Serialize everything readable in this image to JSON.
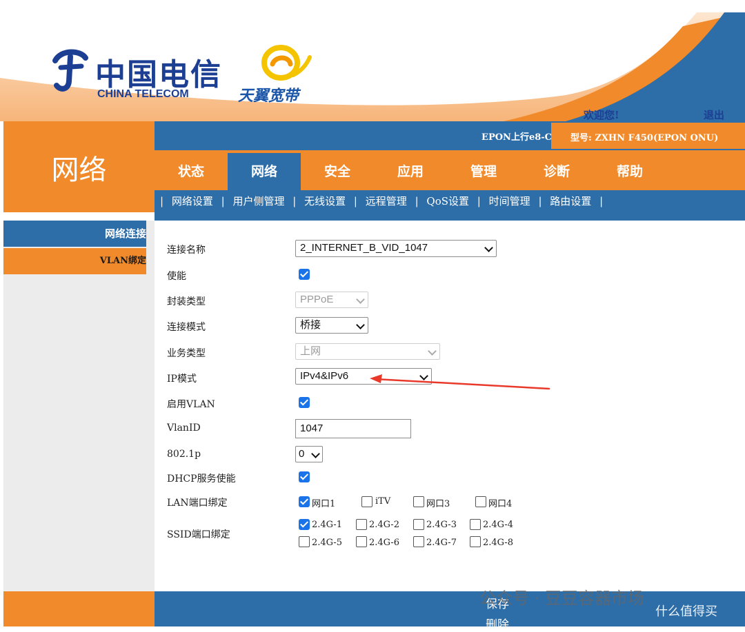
{
  "header": {
    "brand_cn": "中国电信",
    "brand_en": "CHINA TELECOM",
    "sub_brand": "天翼宽带",
    "welcome": "欢迎您!",
    "logout": "退出"
  },
  "top_bar": {
    "epon": "EPON上行e8-C",
    "model": "型号: ZXHN F450(EPON ONU)"
  },
  "section_title": "网络",
  "tabs": [
    {
      "label": "状态",
      "active": false
    },
    {
      "label": "网络",
      "active": true
    },
    {
      "label": "安全",
      "active": false
    },
    {
      "label": "应用",
      "active": false
    },
    {
      "label": "管理",
      "active": false
    },
    {
      "label": "诊断",
      "active": false
    },
    {
      "label": "帮助",
      "active": false
    }
  ],
  "subnav": [
    "网络设置",
    "用户侧管理",
    "无线设置",
    "远程管理",
    "QoS设置",
    "时间管理",
    "路由设置"
  ],
  "sidebar": {
    "items": [
      {
        "label": "网络连接",
        "active": true
      },
      {
        "label": "VLAN绑定",
        "active": false
      }
    ]
  },
  "form": {
    "connection_name": {
      "label": "连接名称",
      "value": "2_INTERNET_B_VID_1047"
    },
    "enable": {
      "label": "使能",
      "checked": true
    },
    "encap_type": {
      "label": "封装类型",
      "value": "PPPoE",
      "disabled": true
    },
    "conn_mode": {
      "label": "连接模式",
      "value": "桥接"
    },
    "service_type": {
      "label": "业务类型",
      "value": "上网",
      "disabled": true
    },
    "ip_mode": {
      "label": "IP模式",
      "value": "IPv4&IPv6"
    },
    "enable_vlan": {
      "label": "启用VLAN",
      "checked": true
    },
    "vlan_id": {
      "label": "VlanID",
      "value": "1047"
    },
    "dot1p": {
      "label": "802.1p",
      "value": "0"
    },
    "dhcp_enable": {
      "label": "DHCP服务使能",
      "checked": true
    },
    "lan_binding": {
      "label": "LAN端口绑定",
      "ports": [
        {
          "label": "网口1",
          "checked": true
        },
        {
          "label": "iTV",
          "checked": false
        },
        {
          "label": "网口3",
          "checked": false
        },
        {
          "label": "网口4",
          "checked": false
        }
      ]
    },
    "ssid_binding": {
      "label": "SSID端口绑定",
      "ssids": [
        {
          "label": "2.4G-1",
          "checked": true
        },
        {
          "label": "2.4G-2",
          "checked": false
        },
        {
          "label": "2.4G-3",
          "checked": false
        },
        {
          "label": "2.4G-4",
          "checked": false
        },
        {
          "label": "2.4G-5",
          "checked": false
        },
        {
          "label": "2.4G-6",
          "checked": false
        },
        {
          "label": "2.4G-7",
          "checked": false
        },
        {
          "label": "2.4G-8",
          "checked": false
        }
      ]
    }
  },
  "actions": {
    "save": "保存",
    "delete": "删除"
  },
  "watermark": {
    "text": "公众号 · 豆豆容器市场",
    "sub": "什么值得买"
  },
  "colors": {
    "orange": "#f08a2a",
    "blue": "#2e6ea8",
    "checkbox": "#1a73e8",
    "arrow": "#e8392b"
  }
}
